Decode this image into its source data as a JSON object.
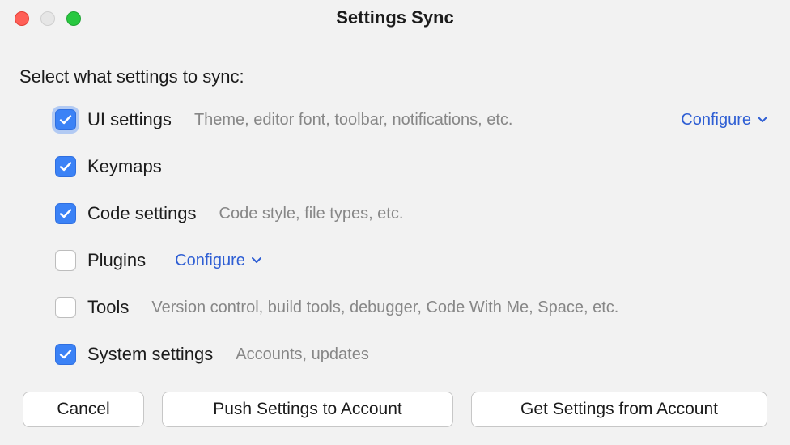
{
  "window": {
    "title": "Settings Sync"
  },
  "prompt": "Select what settings to sync:",
  "items": [
    {
      "label": "UI settings",
      "desc": "Theme, editor font, toolbar, notifications, etc.",
      "checked": true,
      "focused": true,
      "configure": "Configure",
      "configure_pos": "right"
    },
    {
      "label": "Keymaps",
      "desc": "",
      "checked": true,
      "focused": false,
      "configure": ""
    },
    {
      "label": "Code settings",
      "desc": "Code style, file types, etc.",
      "checked": true,
      "focused": false,
      "configure": ""
    },
    {
      "label": "Plugins",
      "desc": "",
      "checked": false,
      "focused": false,
      "configure": "Configure",
      "configure_pos": "inline"
    },
    {
      "label": "Tools",
      "desc": "Version control, build tools, debugger, Code With Me, Space, etc.",
      "checked": false,
      "focused": false,
      "configure": ""
    },
    {
      "label": "System settings",
      "desc": "Accounts, updates",
      "checked": true,
      "focused": false,
      "configure": ""
    }
  ],
  "buttons": {
    "cancel": "Cancel",
    "push": "Push Settings to Account",
    "get": "Get Settings from Account"
  },
  "colors": {
    "link": "#2f5fd4",
    "accent": "#3b82f6"
  }
}
